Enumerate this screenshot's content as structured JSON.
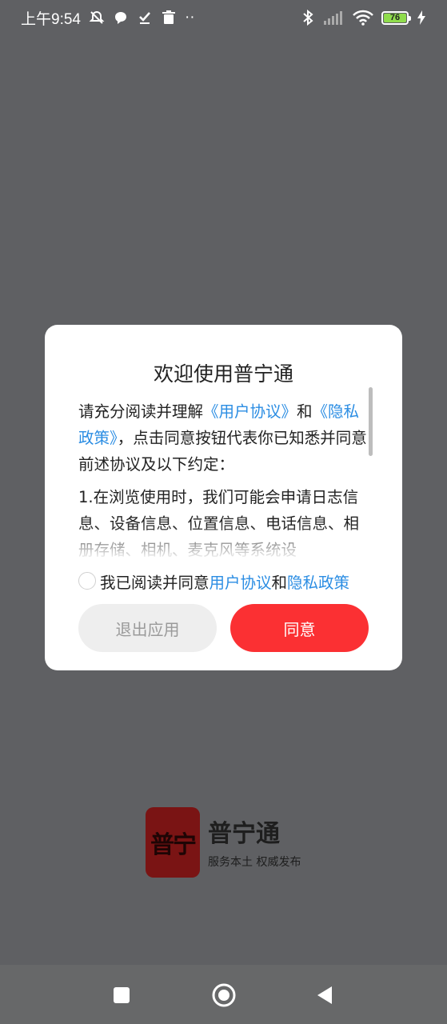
{
  "status_bar": {
    "time": "上午9:54",
    "dots": "··",
    "battery_level": "76",
    "icons": [
      "alarm-off-icon",
      "chat-icon",
      "check-icon",
      "trash-icon",
      "bluetooth-icon",
      "signal-icon",
      "wifi-icon",
      "battery-icon",
      "charging-icon"
    ]
  },
  "dialog": {
    "title": "欢迎使用普宁通",
    "intro_prefix": "请充分阅读并理解",
    "intro_link_1": "《用户协议》",
    "intro_and": "和",
    "intro_link_2": "《隐私政策》",
    "intro_suffix": "，点击同意按钮代表你已知悉并同意前述协议及以下约定：",
    "clause_1": "1.在浏览使用时，我们可能会申请日志信息、设备信息、位置信息、电话信息、相册存储、相机、麦克风等系统设",
    "consent_prefix": "我已阅读并同意",
    "consent_link_1": "用户协议",
    "consent_and": "和",
    "consent_link_2": "隐私政策",
    "exit_label": "退出应用",
    "agree_label": "同意"
  },
  "logo": {
    "tile_text": "普宁",
    "name": "普宁通",
    "slogan": "服务本土 权威发布"
  },
  "colors": {
    "accent_red": "#fb3033",
    "link_blue": "#2b8de3",
    "backdrop": "#5f6063",
    "logo_red": "#7a1414"
  }
}
